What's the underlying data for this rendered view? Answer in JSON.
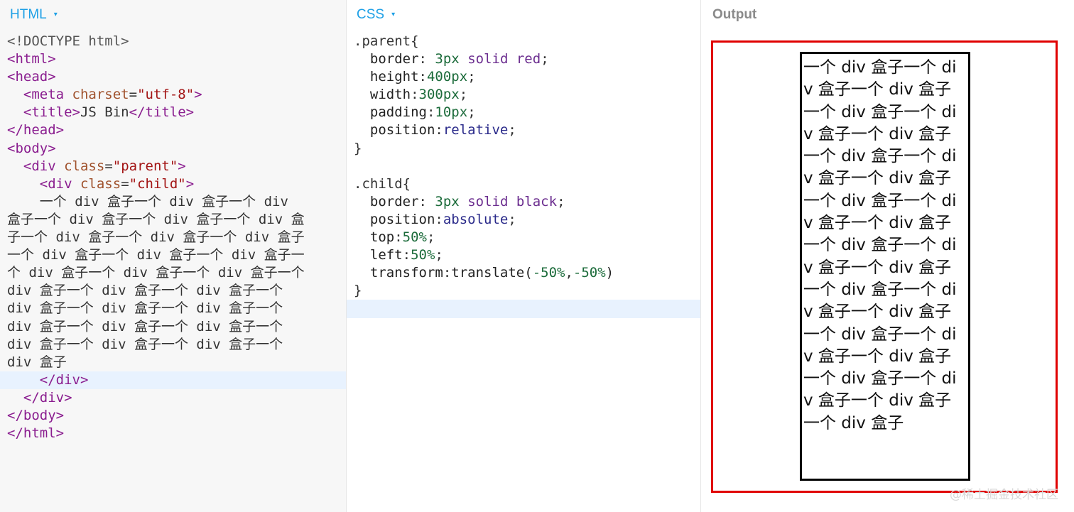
{
  "html_pane": {
    "title": "HTML",
    "caret": "▾",
    "lines": [
      "<!DOCTYPE html>",
      "<html>",
      "<head>",
      "<meta charset=\"utf-8\">",
      "<title>JS Bin</title>",
      "</head>",
      "<body>",
      "<div class=\"parent\">",
      "<div class=\"child\">",
      "一个 div 盒子一个 div 盒子一个 div 盒子一个 div 盒子一个 div 盒子一个 div 盒子一个 div 盒子一个 div 盒子一个 div 盒子一个 div 盒子一个 div 盒子一个 div 盒子一个 div 盒子一个 div 盒子一个 div 盒子一个 div 盒子一个 div 盒子一个 div 盒子一个 div 盒子一个 div 盒子一个 div 盒子一个 div 盒子一个 div 盒子一个 div 盒子一个 div 盒子",
      "</div>",
      "</div>",
      "</body>",
      "</html>"
    ],
    "wrapped_text_rows": [
      "    一个 div 盒子一个 div 盒子一个 div",
      "盒子一个 div 盒子一个 div 盒子一个 div 盒",
      "子一个 div 盒子一个 div 盒子一个 div 盒子",
      "一个 div 盒子一个 div 盒子一个 div 盒子一",
      "个 div 盒子一个 div 盒子一个 div 盒子一个",
      "div 盒子一个 div 盒子一个 div 盒子一个",
      "div 盒子一个 div 盒子一个 div 盒子一个",
      "div 盒子一个 div 盒子一个 div 盒子一个",
      "div 盒子一个 div 盒子一个 div 盒子一个",
      "div 盒子"
    ]
  },
  "css_pane": {
    "title": "CSS",
    "caret": "▾",
    "parent_selector": ".parent{",
    "parent_rules": [
      {
        "prop": "border",
        "sep": ": ",
        "num": "3px",
        "kw1": "solid",
        "kw2": "red"
      },
      {
        "prop": "height",
        "sep": ":",
        "num": "400px"
      },
      {
        "prop": "width",
        "sep": ":",
        "num": "300px"
      },
      {
        "prop": "padding",
        "sep": ":",
        "num": "10px"
      },
      {
        "prop": "position",
        "sep": ":",
        "atom": "relative"
      }
    ],
    "child_selector": ".child{",
    "child_rules": [
      {
        "prop": "border",
        "sep": ": ",
        "num": "3px",
        "kw1": "solid",
        "kw2": "black"
      },
      {
        "prop": "position",
        "sep": ":",
        "atom": "absolute"
      },
      {
        "prop": "top",
        "sep": ":",
        "num": "50%"
      },
      {
        "prop": "left",
        "sep": ":",
        "num": "50%"
      },
      {
        "prop": "transform",
        "sep": ":",
        "fn": "translate",
        "args": "-50%,-50%"
      }
    ],
    "close_brace": "}"
  },
  "output_pane": {
    "title": "Output",
    "child_text": "一个 div 盒子一个 div 盒子一个 div 盒子一个 div 盒子一个 div 盒子一个 div 盒子一个 div 盒子一个 div 盒子一个 div 盒子一个 div 盒子一个 div 盒子一个 div 盒子一个 div 盒子一个 div 盒子一个 div 盒子一个 div 盒子一个 div 盒子一个 div 盒子一个 div 盒子一个 div 盒子一个 div 盒子一个 div 盒子一个 div 盒子一个 div 盒子一个 div 盒子",
    "parent_border_color": "#e00000",
    "child_border_color": "#000000"
  },
  "watermark": "@稀土掘金技术社区",
  "colors": {
    "accent": "#1ea0e6",
    "tag": "#8a1d8f",
    "string": "#a31515",
    "number": "#1b6b3a",
    "keyword": "#6b2d8f"
  }
}
